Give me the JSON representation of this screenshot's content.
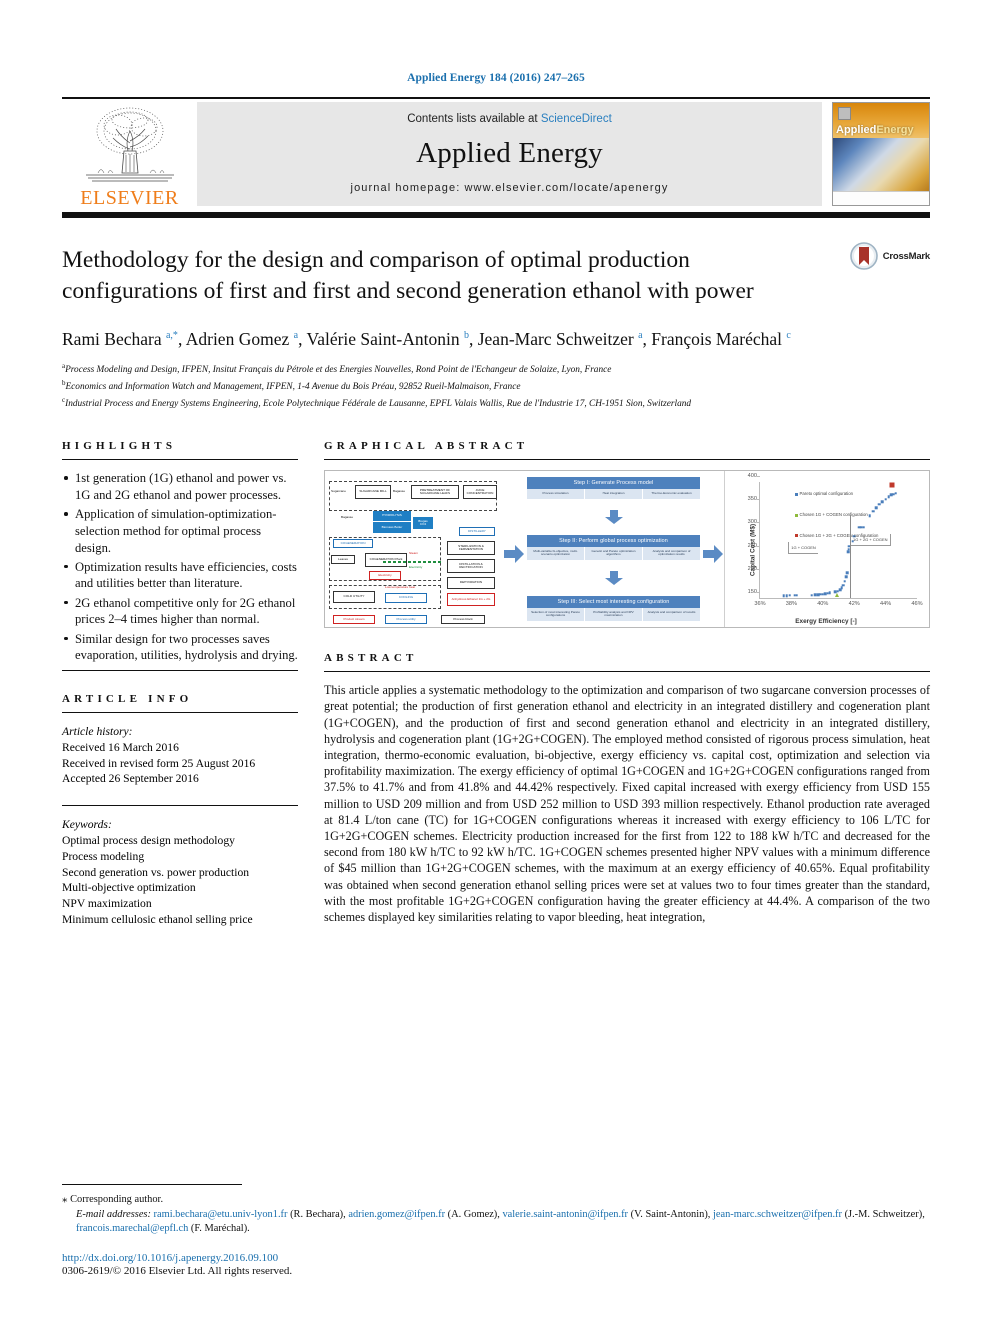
{
  "running_head": "Applied Energy 184 (2016) 247–265",
  "masthead": {
    "contents_prefix": "Contents lists available at ",
    "sciencedirect": "ScienceDirect",
    "journal_title": "Applied Energy",
    "homepage": "journal homepage: www.elsevier.com/locate/apenergy",
    "publisher": "ELSEVIER",
    "cover_name_1": "Applied",
    "cover_name_2": "Energy"
  },
  "article": {
    "title": "Methodology for the design and comparison of optimal production configurations of first and first and second generation ethanol with power",
    "crossmark_label": "CrossMark",
    "authors_html": "Rami Bechara <sup>a,*</sup>, Adrien Gomez <sup>a</sup>, Valérie Saint-Antonin <sup>b</sup>, Jean-Marc Schweitzer <sup>a</sup>, François Maréchal <sup>c</sup>",
    "affiliations": [
      {
        "sup": "a",
        "text": "Process Modeling and Design, IFPEN, Insitut Français du Pétrole et des Energies Nouvelles, Rond Point de l'Echangeur de Solaize, Lyon, France"
      },
      {
        "sup": "b",
        "text": "Economics and Information Watch and Management, IFPEN, 1-4 Avenue du Bois Préau, 92852 Rueil-Malmaison, France"
      },
      {
        "sup": "c",
        "text": "Industrial Process and Energy Systems Engineering, Ecole Polytechnique Fédérale de Lausanne, EPFL Valais Wallis, Rue de l'Industrie 17, CH-1951 Sion, Switzerland"
      }
    ]
  },
  "highlights": {
    "heading": "HIGHLIGHTS",
    "items": [
      "1st generation (1G) ethanol and power vs. 1G and 2G ethanol and power processes.",
      "Application of simulation-optimization-selection method for optimal process design.",
      "Optimization results have efficiencies, costs and utilities better than literature.",
      "2G ethanol competitive only for 2G ethanol prices 2–4 times higher than normal.",
      "Similar design for two processes saves evaporation, utilities, hydrolysis and drying."
    ]
  },
  "article_info": {
    "heading": "ARTICLE INFO",
    "history_label": "Article history:",
    "history": [
      "Received 16 March 2016",
      "Received in revised form 25 August 2016",
      "Accepted 26 September 2016"
    ],
    "keywords_label": "Keywords:",
    "keywords": [
      "Optimal process design methodology",
      "Process modeling",
      "Second generation vs. power production",
      "Multi-objective optimization",
      "NPV maximization",
      "Minimum cellulosic ethanol selling price"
    ]
  },
  "graphical_abstract": {
    "heading": "GRAPHICAL ABSTRACT",
    "flow_diagram": {
      "boxes": [
        "Sugarcane",
        "SUGARCANE MILL",
        "Bagasse",
        "PRETREATMENT OF SUGARCANE LEAFS",
        "JUICE CONCENTRATION",
        "HYDROLYSIS",
        "Bagasse",
        "Biomass Boiler",
        "Biogas CO2",
        "DISTILLERY",
        "COGENERATION",
        "COGENERATION Plant",
        "Leaves",
        "Electricity",
        "STERILIZATION & FERMENTATION",
        "DISTILLATION & RECTIFICATION",
        "DEHYDRATION",
        "Anhydrous Ethanol 1G + 2G",
        "COLD UTILITY",
        "COOLING"
      ],
      "labels": [
        "Steam",
        "Electricity",
        "Low temperature heat"
      ],
      "legend": [
        "Product stream",
        "Process utility",
        "Process block"
      ]
    },
    "steps": [
      {
        "title": "Step I: Generate Process model",
        "subs": [
          "Process simulation",
          "Heat integration",
          "Thermo-Economic evaluation"
        ]
      },
      {
        "title": "Step II: Perform global process optimization",
        "subs": [
          "Multi-variable bi-objective, multi-scenario optimization",
          "Genetic and Pareto optimization algorithms",
          "Analysis and comparison of optimization results"
        ]
      },
      {
        "title": "Step III: Select most interesting configuration",
        "subs": [
          "Selection of most interesting Pareto configurations",
          "Profitability analysis and NPV maximization",
          "Analysis and comparison of results"
        ]
      }
    ]
  },
  "chart_data": {
    "type": "scatter",
    "title": "",
    "xlabel": "Exergy Efficiency [-]",
    "ylabel": "Capital Cost (M$)",
    "xlim": [
      36,
      46
    ],
    "ylim": [
      150,
      400
    ],
    "xticks": [
      "36%",
      "38%",
      "40%",
      "42%",
      "44%",
      "46%"
    ],
    "yticks": [
      "150",
      "200",
      "250",
      "300",
      "350",
      "400"
    ],
    "grid": false,
    "legend_position": "top-left",
    "legend": [
      "Pareto optimal configuration",
      "Chosen 1G + COGEN configuration",
      "Chosen 1G + 2G + COGEN configuration"
    ],
    "annotations": [
      "1G + COGEN",
      "1G + 2G + COGEN"
    ],
    "series": [
      {
        "name": "Pareto optimal configuration",
        "marker": "diamond",
        "color": "#4a7ebb",
        "points": [
          [
            37.5,
            155
          ],
          [
            37.7,
            155
          ],
          [
            37.9,
            156
          ],
          [
            38.2,
            156
          ],
          [
            38.35,
            156
          ],
          [
            39.3,
            156
          ],
          [
            39.5,
            157
          ],
          [
            39.7,
            157
          ],
          [
            39.85,
            158
          ],
          [
            40.0,
            158
          ],
          [
            40.15,
            159
          ],
          [
            40.3,
            160
          ],
          [
            40.45,
            161
          ],
          [
            40.8,
            163
          ],
          [
            40.95,
            165
          ],
          [
            41.1,
            168
          ],
          [
            41.2,
            172
          ],
          [
            41.3,
            178
          ],
          [
            41.4,
            186
          ],
          [
            41.5,
            196
          ],
          [
            41.55,
            205
          ],
          [
            41.6,
            250
          ],
          [
            41.65,
            255
          ],
          [
            41.7,
            262
          ],
          [
            41.9,
            272
          ],
          [
            42.0,
            283
          ],
          [
            42.3,
            303
          ],
          [
            42.45,
            303
          ],
          [
            42.6,
            303
          ],
          [
            43.0,
            328
          ],
          [
            43.2,
            337
          ],
          [
            43.4,
            345
          ],
          [
            43.6,
            352
          ],
          [
            43.8,
            358
          ],
          [
            44.0,
            363
          ],
          [
            44.2,
            368
          ],
          [
            44.35,
            372
          ],
          [
            44.5,
            374
          ],
          [
            44.65,
            376
          ]
        ]
      },
      {
        "name": "Chosen 1G + COGEN configuration",
        "marker": "triangle",
        "color": "#8fba3c",
        "points": [
          [
            40.9,
            157
          ]
        ]
      },
      {
        "name": "Chosen 1G + 2G + COGEN configuration",
        "marker": "square",
        "color": "#c0392b",
        "points": [
          [
            44.4,
            393
          ]
        ]
      }
    ]
  },
  "abstract": {
    "heading": "ABSTRACT",
    "text": "This article applies a systematic methodology to the optimization and comparison of two sugarcane conversion processes of great potential; the production of first generation ethanol and electricity in an integrated distillery and cogeneration plant (1G+COGEN), and the production of first and second generation ethanol and electricity in an integrated distillery, hydrolysis and cogeneration plant (1G+2G+COGEN). The employed method consisted of rigorous process simulation, heat integration, thermo-economic evaluation, bi-objective, exergy efficiency vs. capital cost, optimization and selection via profitability maximization. The exergy efficiency of optimal 1G+COGEN and 1G+2G+COGEN configurations ranged from 37.5% to 41.7% and from 41.8% and 44.42% respectively. Fixed capital increased with exergy efficiency from USD 155 million to USD 209 million and from USD 252 million to USD 393 million respectively. Ethanol production rate averaged at 81.4 L/ton cane (TC) for 1G+COGEN configurations whereas it increased with exergy efficiency to 106 L/TC for 1G+2G+COGEN schemes. Electricity production increased for the first from 122 to 188 kW h/TC and decreased for the second from 180 kW h/TC to 92 kW h/TC. 1G+COGEN schemes presented higher NPV values with a minimum difference of $45 million than 1G+2G+COGEN schemes, with the maximum at an exergy efficiency of 40.65%. Equal profitability was obtained when second generation ethanol selling prices were set at values two to four times greater than the standard, with the most profitable 1G+2G+COGEN configuration having the greater efficiency at 44.4%. A comparison of the two schemes displayed key similarities relating to vapor bleeding, heat integration,"
  },
  "footer": {
    "corresponding_label": "Corresponding author.",
    "email_label": "E-mail addresses:",
    "emails_html": "<a class=\"lnk\" href=\"#\">rami.bechara@etu.univ-lyon1.fr</a> (R. Bechara), <a class=\"lnk\" href=\"#\">adrien.gomez@ifpen.fr</a> (A. Gomez), <a class=\"lnk\" href=\"#\">valerie.saint-antonin@ifpen.fr</a> (V. Saint-Antonin), <a class=\"lnk\" href=\"#\">jean-marc.schweitzer@ifpen.fr</a> (J.-M. Schweitzer), <a class=\"lnk\" href=\"#\">francois.marechal@epfl.ch</a> (F. Maréchal).",
    "doi": "http://dx.doi.org/10.1016/j.apenergy.2016.09.100",
    "copyright": "0306-2619/© 2016 Elsevier Ltd. All rights reserved."
  }
}
